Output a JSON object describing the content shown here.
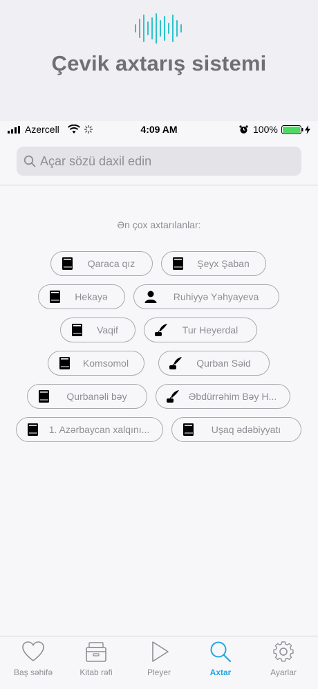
{
  "hero": {
    "title": "Çevik axtarış sistemi"
  },
  "status_bar": {
    "carrier": "Azercell",
    "time": "4:09 AM",
    "battery": "100%",
    "battery_level": 1.0
  },
  "search": {
    "placeholder": "Açar sözü daxil edin",
    "value": ""
  },
  "popular": {
    "title": "Ən çox axtarılanlar:",
    "items": [
      {
        "label": "Qaraca qız",
        "icon": "book-icon"
      },
      {
        "label": "Şeyx Şaban",
        "icon": "book-icon"
      },
      {
        "label": "Hekayə",
        "icon": "book-icon"
      },
      {
        "label": "Ruhiyyə Yəhyayeva",
        "icon": "person-icon"
      },
      {
        "label": "Vaqif",
        "icon": "book-icon"
      },
      {
        "label": "Tur Heyerdal",
        "icon": "quill-inkwell-icon"
      },
      {
        "label": "Komsomol",
        "icon": "book-icon"
      },
      {
        "label": "Qurban Səid",
        "icon": "quill-inkwell-icon"
      },
      {
        "label": "Qurbanəli bəy",
        "icon": "book-icon"
      },
      {
        "label": "Əbdürrəhim Bəy H...",
        "icon": "quill-inkwell-icon"
      },
      {
        "label": "1. Azərbaycan xalqını...",
        "icon": "book-icon"
      },
      {
        "label": "Uşaq ədəbiyyatı",
        "icon": "book-icon"
      }
    ]
  },
  "tabs": [
    {
      "label": "Baş səhifə",
      "icon": "heart-icon",
      "active": false
    },
    {
      "label": "Kitab rəfi",
      "icon": "bookshelf-icon",
      "active": false
    },
    {
      "label": "Pleyer",
      "icon": "play-icon",
      "active": false
    },
    {
      "label": "Axtar",
      "icon": "search-icon",
      "active": true
    },
    {
      "label": "Ayarlar",
      "icon": "gear-icon",
      "active": false
    }
  ],
  "colors": {
    "accent": "#1ea7e4",
    "hero_wave": "#2ec4c9",
    "chip_border": "#a9a9ad",
    "text_muted": "#8e8e93"
  }
}
